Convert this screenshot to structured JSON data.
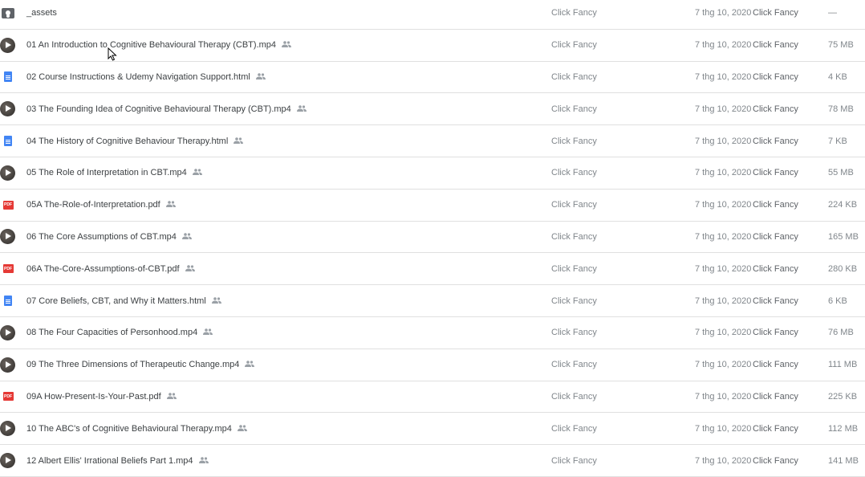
{
  "rows": [
    {
      "type": "folder",
      "icon": "folder-shared-icon",
      "name": "_assets",
      "shared": false,
      "owner": "Click Fancy",
      "modified": "7 thg 10, 2020",
      "modified_by": "Click Fancy",
      "size": "—"
    },
    {
      "type": "video",
      "icon": "video-thumbnail-icon",
      "name": "01 An Introduction to Cognitive Behavioural Therapy (CBT).mp4",
      "shared": true,
      "owner": "Click Fancy",
      "modified": "7 thg 10, 2020",
      "modified_by": "Click Fancy",
      "size": "75 MB"
    },
    {
      "type": "doc",
      "icon": "document-icon",
      "name": "02 Course Instructions & Udemy Navigation Support.html",
      "shared": true,
      "owner": "Click Fancy",
      "modified": "7 thg 10, 2020",
      "modified_by": "Click Fancy",
      "size": "4 KB"
    },
    {
      "type": "video",
      "icon": "video-thumbnail-icon",
      "name": "03 The Founding Idea of Cognitive Behavioural Therapy (CBT).mp4",
      "shared": true,
      "owner": "Click Fancy",
      "modified": "7 thg 10, 2020",
      "modified_by": "Click Fancy",
      "size": "78 MB"
    },
    {
      "type": "doc",
      "icon": "document-icon",
      "name": "04 The History of Cognitive Behaviour Therapy.html",
      "shared": true,
      "owner": "Click Fancy",
      "modified": "7 thg 10, 2020",
      "modified_by": "Click Fancy",
      "size": "7 KB"
    },
    {
      "type": "video",
      "icon": "video-thumbnail-icon",
      "name": "05 The Role of Interpretation in CBT.mp4",
      "shared": true,
      "owner": "Click Fancy",
      "modified": "7 thg 10, 2020",
      "modified_by": "Click Fancy",
      "size": "55 MB"
    },
    {
      "type": "pdf",
      "icon": "pdf-icon",
      "name": "05A The-Role-of-Interpretation.pdf",
      "shared": true,
      "owner": "Click Fancy",
      "modified": "7 thg 10, 2020",
      "modified_by": "Click Fancy",
      "size": "224 KB"
    },
    {
      "type": "video",
      "icon": "video-thumbnail-icon",
      "name": "06 The Core Assumptions of CBT.mp4",
      "shared": true,
      "owner": "Click Fancy",
      "modified": "7 thg 10, 2020",
      "modified_by": "Click Fancy",
      "size": "165 MB"
    },
    {
      "type": "pdf",
      "icon": "pdf-icon",
      "name": "06A The-Core-Assumptions-of-CBT.pdf",
      "shared": true,
      "owner": "Click Fancy",
      "modified": "7 thg 10, 2020",
      "modified_by": "Click Fancy",
      "size": "280 KB"
    },
    {
      "type": "doc",
      "icon": "document-icon",
      "name": "07 Core Beliefs, CBT, and Why it Matters.html",
      "shared": true,
      "owner": "Click Fancy",
      "modified": "7 thg 10, 2020",
      "modified_by": "Click Fancy",
      "size": "6 KB"
    },
    {
      "type": "video",
      "icon": "video-thumbnail-icon",
      "name": "08 The Four Capacities of Personhood.mp4",
      "shared": true,
      "owner": "Click Fancy",
      "modified": "7 thg 10, 2020",
      "modified_by": "Click Fancy",
      "size": "76 MB"
    },
    {
      "type": "video",
      "icon": "video-thumbnail-icon",
      "name": "09 The Three Dimensions of Therapeutic Change.mp4",
      "shared": true,
      "owner": "Click Fancy",
      "modified": "7 thg 10, 2020",
      "modified_by": "Click Fancy",
      "size": "111 MB"
    },
    {
      "type": "pdf",
      "icon": "pdf-icon",
      "name": "09A How-Present-Is-Your-Past.pdf",
      "shared": true,
      "owner": "Click Fancy",
      "modified": "7 thg 10, 2020",
      "modified_by": "Click Fancy",
      "size": "225 KB"
    },
    {
      "type": "video",
      "icon": "video-thumbnail-icon",
      "name": "10 The ABC's of Cognitive Behavioural Therapy.mp4",
      "shared": true,
      "owner": "Click Fancy",
      "modified": "7 thg 10, 2020",
      "modified_by": "Click Fancy",
      "size": "112 MB"
    },
    {
      "type": "video",
      "icon": "video-thumbnail-icon",
      "name": "12 Albert Ellis' Irrational Beliefs Part 1.mp4",
      "shared": true,
      "owner": "Click Fancy",
      "modified": "7 thg 10, 2020",
      "modified_by": "Click Fancy",
      "size": "141 MB"
    }
  ],
  "pdf_badge": "PDF",
  "shared_icon_glyph": "👥"
}
